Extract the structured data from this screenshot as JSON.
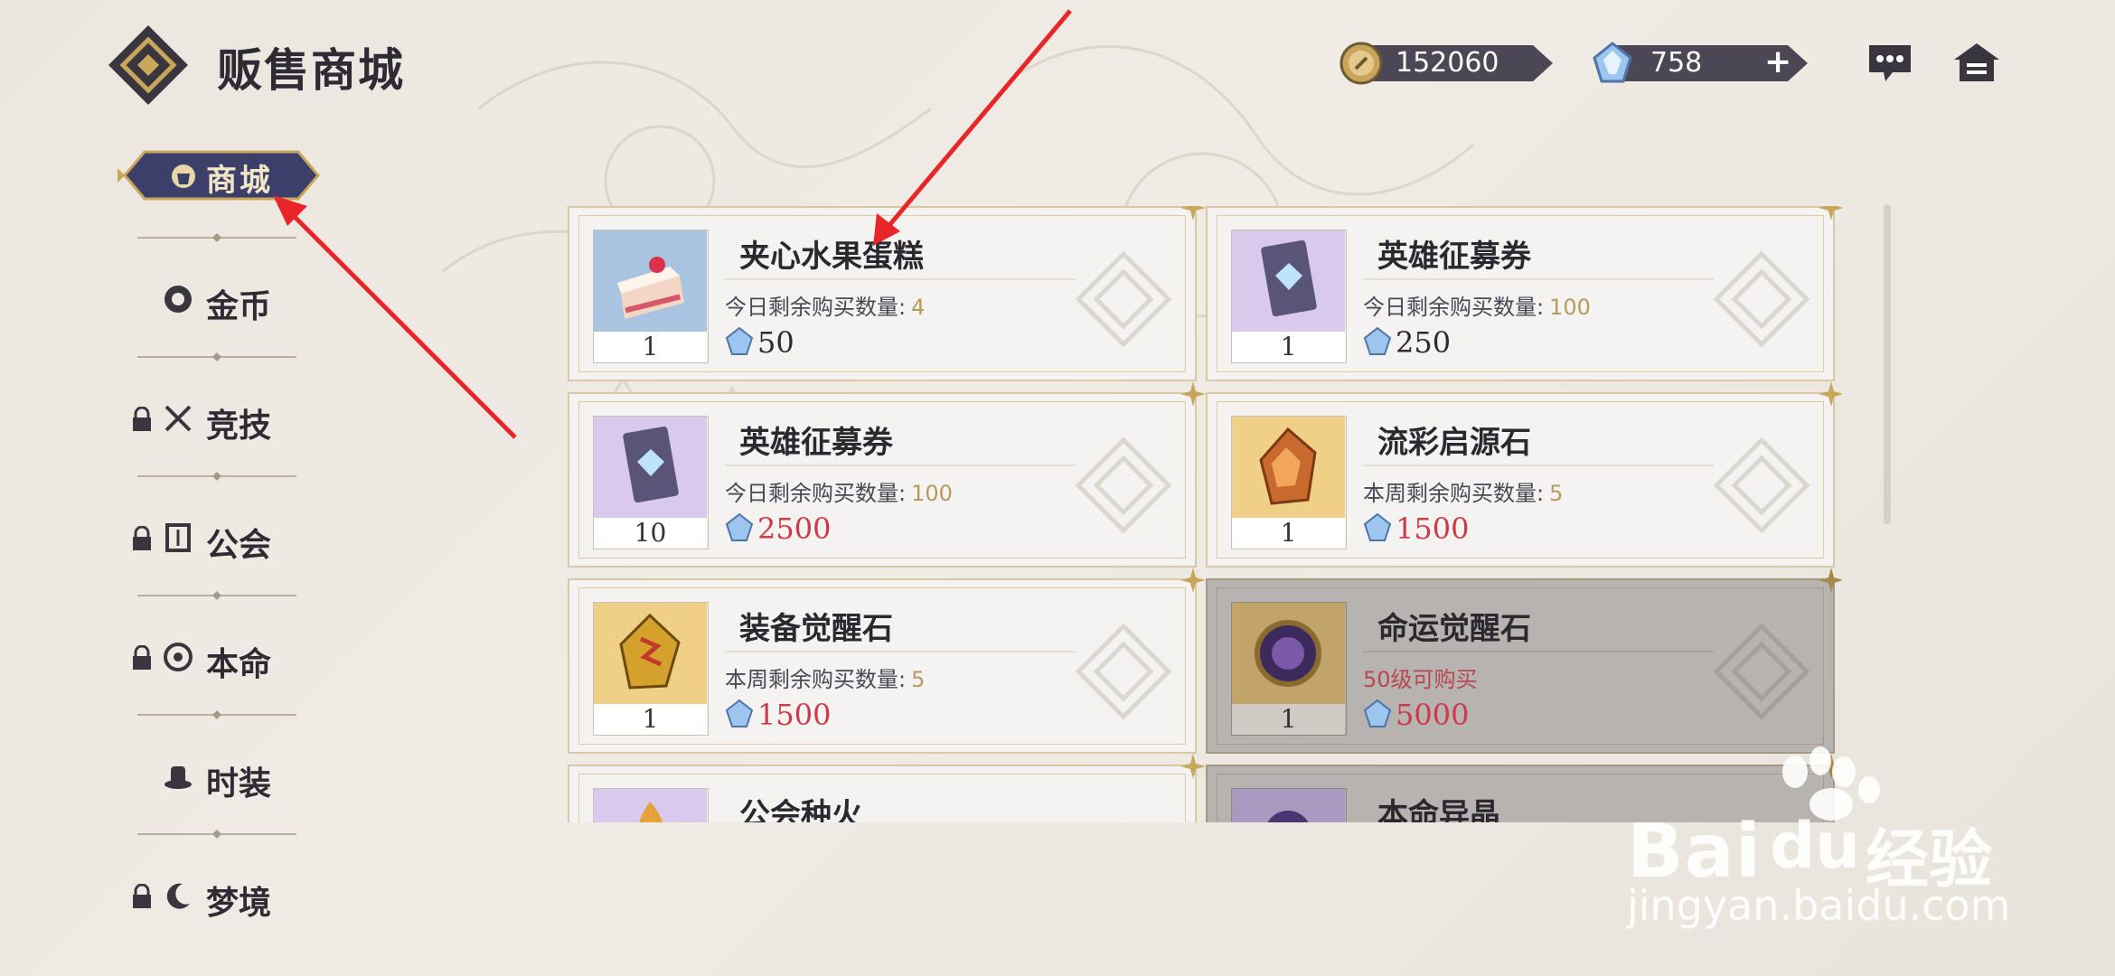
{
  "header": {
    "title": "贩售商城"
  },
  "resources": {
    "gold": "152060",
    "gems": "758",
    "plus": "+"
  },
  "sidebar": {
    "active": "商城",
    "items": [
      {
        "label": "金币",
        "locked": false
      },
      {
        "label": "竞技",
        "locked": true
      },
      {
        "label": "公会",
        "locked": true
      },
      {
        "label": "本命",
        "locked": true
      },
      {
        "label": "时装",
        "locked": false
      },
      {
        "label": "梦境",
        "locked": true
      }
    ]
  },
  "items": [
    {
      "name": "夹心水果蛋糕",
      "limit_label": "今日剩余购买数量:",
      "limit_value": "4",
      "qty": "1",
      "price": "50",
      "price_color": "#2d2a32"
    },
    {
      "name": "英雄征募券",
      "limit_label": "今日剩余购买数量:",
      "limit_value": "100",
      "qty": "1",
      "price": "250",
      "price_color": "#2d2a32"
    },
    {
      "name": "英雄征募券",
      "limit_label": "今日剩余购买数量:",
      "limit_value": "100",
      "qty": "10",
      "price": "2500",
      "price_color": "#d0394a"
    },
    {
      "name": "流彩启源石",
      "limit_label": "本周剩余购买数量:",
      "limit_value": "5",
      "qty": "1",
      "price": "1500",
      "price_color": "#d0394a"
    },
    {
      "name": "装备觉醒石",
      "limit_label": "本周剩余购买数量:",
      "limit_value": "5",
      "qty": "1",
      "price": "1500",
      "price_color": "#d0394a"
    },
    {
      "name": "命运觉醒石",
      "limit_label": "50级可购买",
      "limit_value": "",
      "qty": "1",
      "price": "5000",
      "price_color": "#d0394a"
    },
    {
      "name": "公会种火"
    },
    {
      "name": "本命异晶"
    }
  ],
  "watermark": {
    "brand": "Bai",
    "brand2": "du",
    "cn": "经验",
    "url": "jingyan.baidu.com"
  },
  "colors": {
    "accent_red": "#d0394a",
    "panel_dark": "#4b4754",
    "gold": "#c8a65a",
    "annotation_arrow": "#e8262a"
  }
}
